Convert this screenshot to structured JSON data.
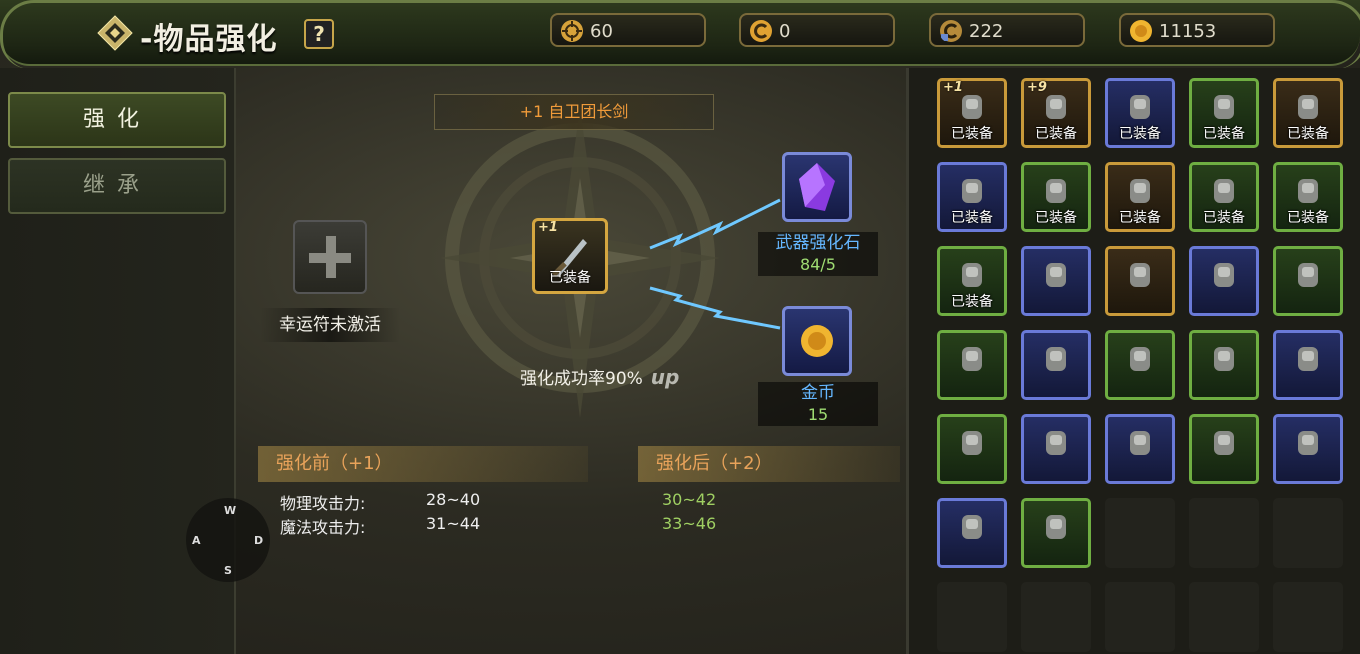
{
  "header": {
    "title": "-物品强化",
    "help_label": "?",
    "currencies": [
      {
        "icon": "target-coin-icon",
        "value": "60"
      },
      {
        "icon": "c-coin-icon",
        "value": "0"
      },
      {
        "icon": "bound-c-coin-icon",
        "value": "222"
      },
      {
        "icon": "gold-coin-icon",
        "value": "11153"
      }
    ]
  },
  "tabs": {
    "enhance": "强化",
    "inherit": "继承"
  },
  "enhance": {
    "item_name": "+1 自卫团长剑",
    "item_plus": "+1",
    "equipped": "已装备",
    "lucky_label": "幸运符未激活",
    "success_rate": "强化成功率90%",
    "up_label": "up",
    "material1": {
      "name": "武器强化石",
      "qty": "84/5"
    },
    "material2": {
      "name": "金币",
      "qty": "15"
    },
    "before_title": "强化前（+1）",
    "after_title": "强化后（+2）",
    "stats": [
      {
        "name": "物理攻击力:",
        "before": "28~40",
        "after": "30~42"
      },
      {
        "name": "魔法攻击力:",
        "before": "31~44",
        "after": "33~46"
      }
    ]
  },
  "dpad": {
    "up": "W",
    "left": "A",
    "right": "D",
    "down": "S"
  },
  "colors": {
    "accent": "#d4a640",
    "frame": "#6b7d45",
    "quality_gold": "#c99a3a",
    "quality_blue": "#6a7ad8",
    "quality_green": "#6fae42"
  },
  "inventory": [
    {
      "q": "gold",
      "plus": "+1",
      "label": "已装备",
      "icon": "weapon-checkmark-icon"
    },
    {
      "q": "gold",
      "plus": "+9",
      "label": "已装备",
      "icon": "armor-chest-icon"
    },
    {
      "q": "blue",
      "plus": "",
      "label": "已装备",
      "icon": "helmet-icon"
    },
    {
      "q": "green",
      "plus": "",
      "label": "已装备",
      "icon": "shirt-icon"
    },
    {
      "q": "gold",
      "plus": "",
      "label": "已装备",
      "icon": "pants-icon"
    },
    {
      "q": "blue",
      "plus": "",
      "label": "已装备",
      "icon": "boots-icon"
    },
    {
      "q": "green",
      "plus": "",
      "label": "已装备",
      "icon": "shoulder-icon"
    },
    {
      "q": "gold",
      "plus": "",
      "label": "已装备",
      "icon": "necklace-icon"
    },
    {
      "q": "green",
      "plus": "",
      "label": "已装备",
      "icon": "earring-icon"
    },
    {
      "q": "green",
      "plus": "",
      "label": "已装备",
      "icon": "ring-icon"
    },
    {
      "q": "green",
      "plus": "",
      "label": "已装备",
      "icon": "ring-icon"
    },
    {
      "q": "blue",
      "plus": "",
      "label": "",
      "icon": "axe-icon"
    },
    {
      "q": "gold",
      "plus": "",
      "label": "",
      "icon": "hammer-icon"
    },
    {
      "q": "blue",
      "plus": "",
      "label": "",
      "icon": "axe-icon"
    },
    {
      "q": "green",
      "plus": "",
      "label": "",
      "icon": "drill-icon"
    },
    {
      "q": "green",
      "plus": "",
      "label": "",
      "icon": "double-axe-icon"
    },
    {
      "q": "blue",
      "plus": "",
      "label": "",
      "icon": "hammer-icon"
    },
    {
      "q": "green",
      "plus": "",
      "label": "",
      "icon": "necklace-icon"
    },
    {
      "q": "green",
      "plus": "",
      "label": "",
      "icon": "gauntlet-icon"
    },
    {
      "q": "blue",
      "plus": "",
      "label": "",
      "icon": "necklace-icon"
    },
    {
      "q": "green",
      "plus": "",
      "label": "",
      "icon": "earring-icon"
    },
    {
      "q": "blue",
      "plus": "",
      "label": "",
      "icon": "helmet-icon"
    },
    {
      "q": "blue",
      "plus": "",
      "label": "",
      "icon": "sword-icon"
    },
    {
      "q": "green",
      "plus": "",
      "label": "",
      "icon": "earring-icon"
    },
    {
      "q": "blue",
      "plus": "",
      "label": "",
      "icon": "glove-icon"
    },
    {
      "q": "blue",
      "plus": "",
      "label": "",
      "icon": "glove-icon"
    },
    {
      "q": "green",
      "plus": "",
      "label": "",
      "icon": "ring-icon"
    }
  ]
}
